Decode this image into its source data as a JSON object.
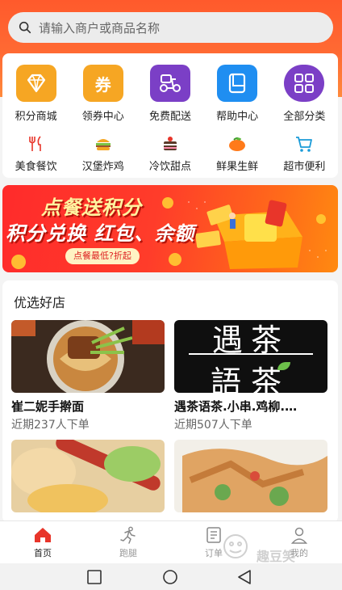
{
  "search": {
    "placeholder": "请输入商户或商品名称"
  },
  "categories_main": [
    {
      "label": "积分商城",
      "icon": "diamond-icon",
      "color": "#f6a623"
    },
    {
      "label": "领券中心",
      "icon": "coupon-icon",
      "color": "#f6a623"
    },
    {
      "label": "免费配送",
      "icon": "scooter-icon",
      "color": "#7b3fc6"
    },
    {
      "label": "帮助中心",
      "icon": "book-icon",
      "color": "#1f8ef1"
    },
    {
      "label": "全部分类",
      "icon": "grid-icon",
      "color": "#7b3fc6"
    }
  ],
  "categories_sub": [
    {
      "label": "美食餐饮",
      "icon": "fork-knife-icon"
    },
    {
      "label": "汉堡炸鸡",
      "icon": "burger-icon"
    },
    {
      "label": "冷饮甜点",
      "icon": "dessert-icon"
    },
    {
      "label": "鲜果生鲜",
      "icon": "fruit-icon"
    },
    {
      "label": "超市便利",
      "icon": "cart-icon"
    }
  ],
  "banner": {
    "line1": "点餐送积分",
    "line2": "积分兑换 红包、余额",
    "pill": "点餐最低?折起"
  },
  "shops_section": {
    "title": "优选好店",
    "shops": [
      {
        "name": "崔二妮手擀面",
        "orders": "近期237人下单"
      },
      {
        "name": "遇茶语茶.小串.鸡柳.…",
        "orders": "近期507人下单",
        "logo_text_top": "遇茶",
        "logo_text_bottom": "語茶"
      },
      {
        "name": "",
        "orders": ""
      },
      {
        "name": "",
        "orders": ""
      }
    ]
  },
  "tabbar": [
    {
      "label": "首页",
      "icon": "home-icon",
      "active": true
    },
    {
      "label": "跑腿",
      "icon": "runner-icon",
      "active": false
    },
    {
      "label": "订单",
      "icon": "order-list-icon",
      "active": false
    },
    {
      "label": "我的",
      "icon": "user-icon",
      "active": false
    }
  ],
  "watermark": {
    "text": "趣豆笑"
  },
  "colors": {
    "primary": "#ff5a2c",
    "active_tab": "#e8352a"
  }
}
